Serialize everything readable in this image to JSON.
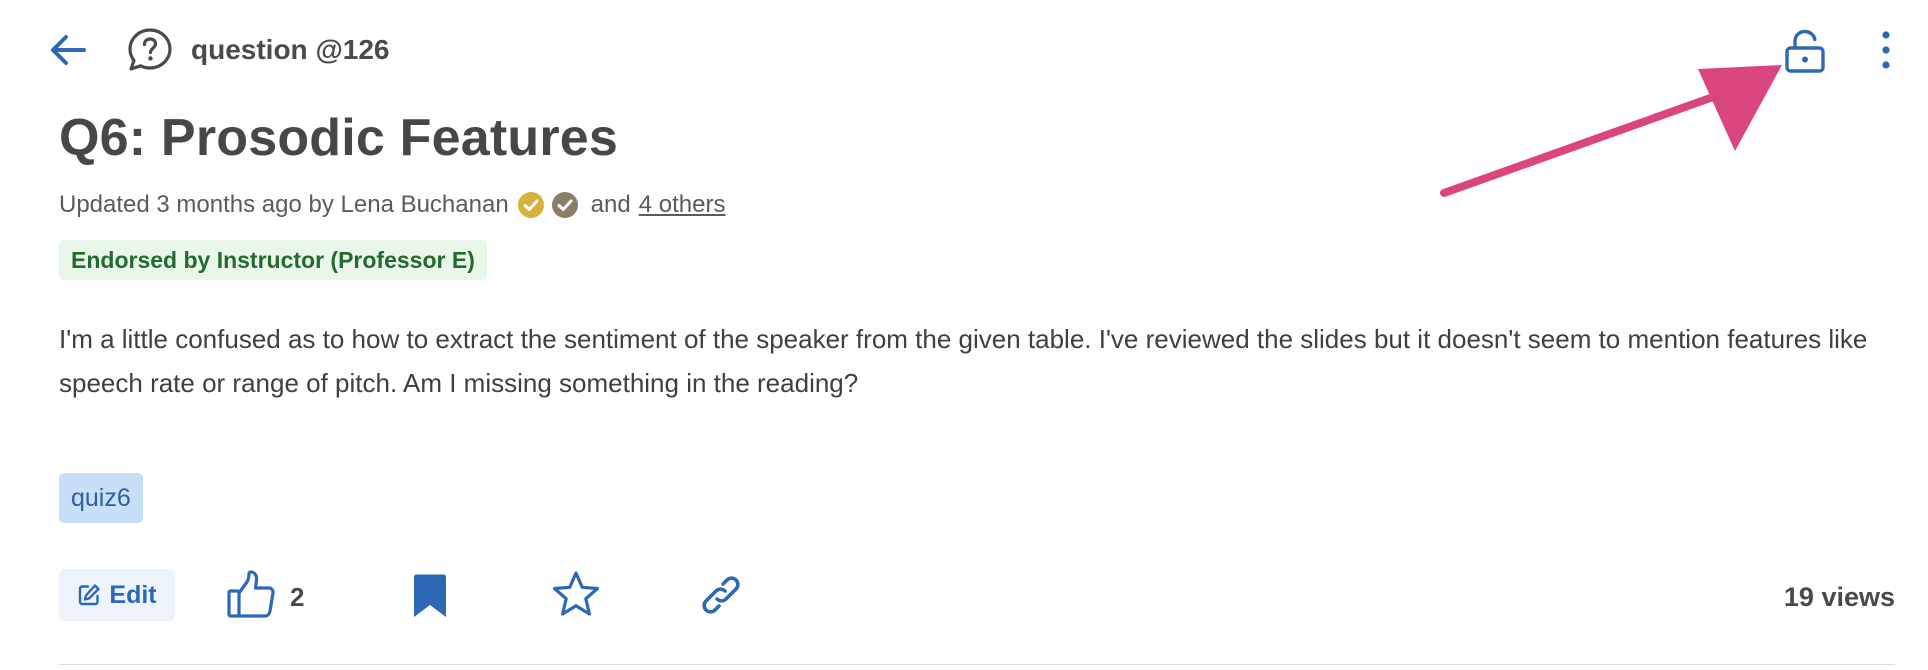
{
  "header": {
    "back_icon": "arrow-left-icon",
    "post_type_icon": "question-bubble-icon",
    "post_label": "question @126",
    "lock_icon": "unlock-icon",
    "more_icon": "kebab-menu-icon"
  },
  "post": {
    "title": "Q6: Prosodic Features",
    "meta": {
      "updated_text": "Updated 3 months ago by Lena Buchanan",
      "badges": [
        "gold-check-badge-icon",
        "gray-check-badge-icon"
      ],
      "and_text": "and",
      "others_link": "4 others"
    },
    "endorsement": "Endorsed by Instructor (Professor E)",
    "body": "I'm a little confused as to how to extract the sentiment of the speaker from the given table.  I've reviewed the slides but it doesn't seem to mention features like speech rate or range of pitch.  Am I missing something in the reading?",
    "tags": [
      "quiz6"
    ]
  },
  "actions": {
    "edit_label": "Edit",
    "like_count": "2",
    "views": "19 views"
  },
  "colors": {
    "accent_blue": "#2c68b5",
    "annotation_arrow": "#d9467e",
    "endorsed_bg": "#e9f7ea",
    "endorsed_text": "#246a2f",
    "tag_bg": "#c9def7",
    "badge_gold": "#d7b33b",
    "badge_gray": "#8b7e69"
  }
}
